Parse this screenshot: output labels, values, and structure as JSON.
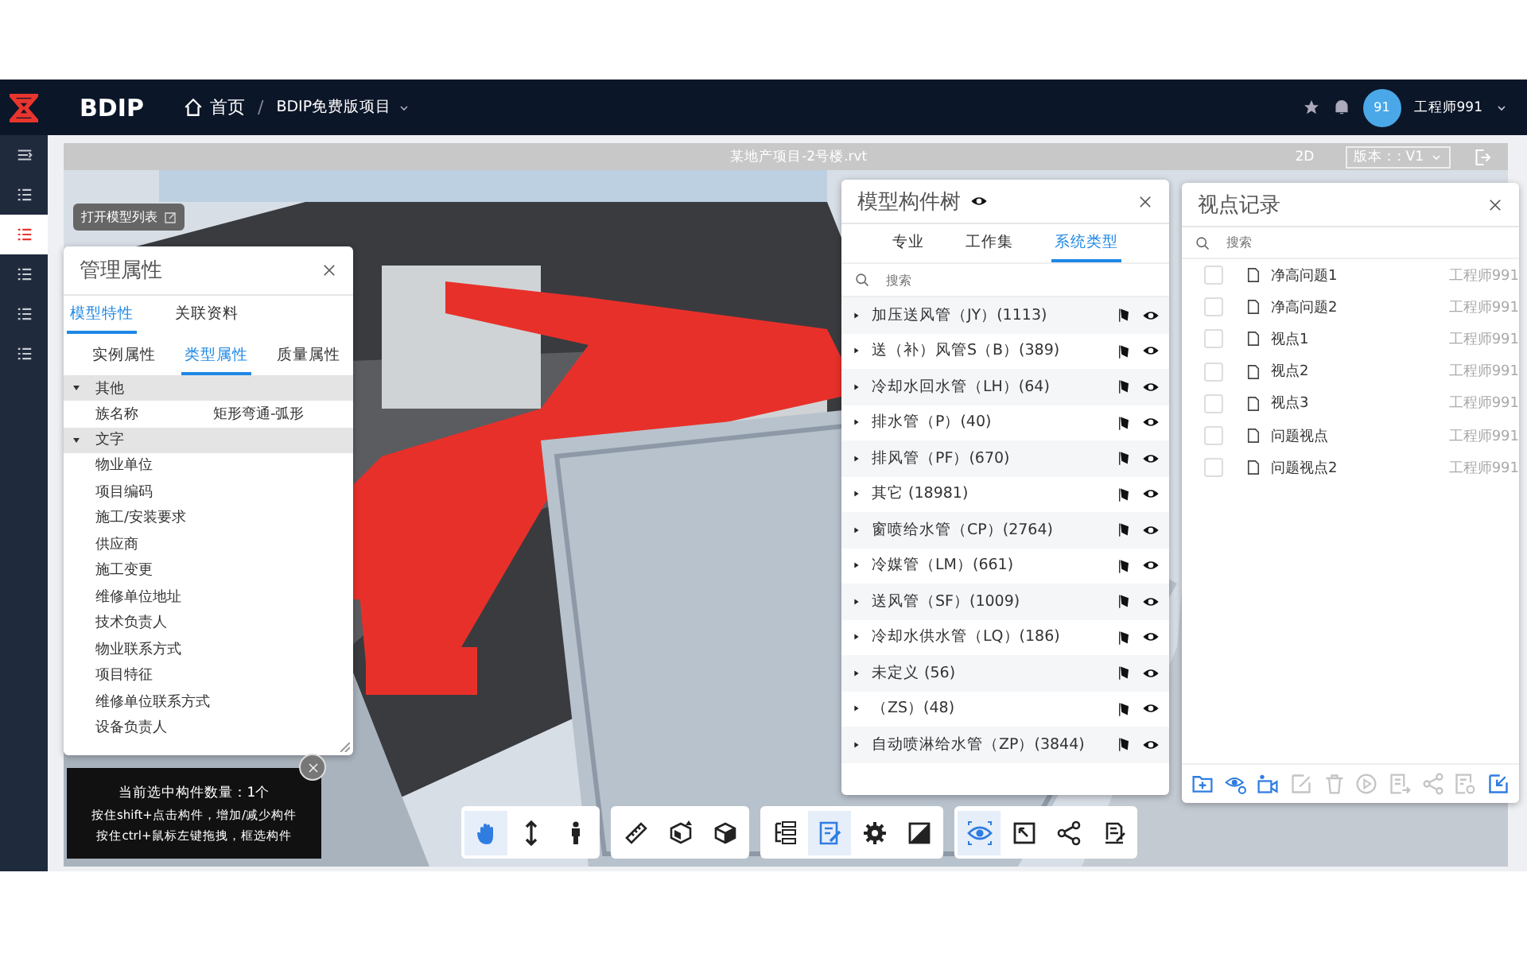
{
  "topbar": {
    "brand": "BDIP",
    "separator": "/",
    "breadcrumb": [
      {
        "label": "首页",
        "kind": "home"
      },
      {
        "label": "BDIP免费版项目",
        "kind": "dropdown"
      }
    ],
    "user": {
      "avatar": "91",
      "name": "工程师991"
    }
  },
  "sidebar": {
    "items": [
      {
        "kind": "collapse",
        "selected": false
      },
      {
        "kind": "list",
        "selected": false
      },
      {
        "kind": "list",
        "selected": true
      },
      {
        "kind": "list",
        "selected": false
      },
      {
        "kind": "list",
        "selected": false
      },
      {
        "kind": "list",
        "selected": false
      }
    ]
  },
  "viewer": {
    "file_title": "某地产项目-2号楼.rvt",
    "mode": "2D",
    "version": "版本：: V1",
    "open_model_list": "打开模型列表"
  },
  "properties_panel": {
    "title": "管理属性",
    "tabs": [
      {
        "label": "模型特性",
        "selected": true
      },
      {
        "label": "关联资料",
        "selected": false
      }
    ],
    "subtabs": [
      {
        "label": "实例属性",
        "selected": false
      },
      {
        "label": "类型属性",
        "selected": true
      },
      {
        "label": "质量属性",
        "selected": false
      }
    ],
    "groups": [
      {
        "name": "其他",
        "expanded": true,
        "rows": [
          {
            "label": "族名称",
            "value": "矩形弯通-弧形"
          }
        ]
      },
      {
        "name": "文字",
        "expanded": true,
        "rows": [
          {
            "label": "物业单位"
          },
          {
            "label": "项目编码"
          },
          {
            "label": "施工/安装要求"
          },
          {
            "label": "供应商"
          },
          {
            "label": "施工变更"
          },
          {
            "label": "维修单位地址"
          },
          {
            "label": "技术负责人"
          },
          {
            "label": "物业联系方式"
          },
          {
            "label": "项目特征"
          },
          {
            "label": "维修单位联系方式"
          },
          {
            "label": "设备负责人"
          }
        ]
      }
    ]
  },
  "tree_panel": {
    "title": "模型构件树",
    "tabs": [
      {
        "label": "专业",
        "selected": false
      },
      {
        "label": "工作集",
        "selected": false
      },
      {
        "label": "系统类型",
        "selected": true
      }
    ],
    "search": {
      "placeholder": "搜索"
    },
    "items": [
      {
        "label": "加压送风管（JY）(1113)"
      },
      {
        "label": "送（补）风管S（B）(389)"
      },
      {
        "label": "冷却水回水管（LH）(64)"
      },
      {
        "label": "排水管（P）(40)"
      },
      {
        "label": "排风管（PF）(670)"
      },
      {
        "label": "其它 (18981)"
      },
      {
        "label": "窗喷给水管（CP）(2764)"
      },
      {
        "label": "冷媒管（LM）(661)"
      },
      {
        "label": "送风管（SF）(1009)"
      },
      {
        "label": "冷却水供水管（LQ）(186)"
      },
      {
        "label": "未定义 (56)"
      },
      {
        "label": "（ZS）(48)"
      },
      {
        "label": "自动喷淋给水管（ZP）(3844)"
      }
    ]
  },
  "viewpoints_panel": {
    "title": "视点记录",
    "search": {
      "placeholder": "搜索"
    },
    "items": [
      {
        "name": "净高问题1",
        "author": "工程师991",
        "checked": false
      },
      {
        "name": "净高问题2",
        "author": "工程师991",
        "checked": false
      },
      {
        "name": "视点1",
        "author": "工程师991",
        "checked": false
      },
      {
        "name": "视点2",
        "author": "工程师991",
        "checked": false
      },
      {
        "name": "视点3",
        "author": "工程师991",
        "checked": false
      },
      {
        "name": "问题视点",
        "author": "工程师991",
        "checked": false
      },
      {
        "name": "问题视点2",
        "author": "工程师991",
        "checked": false
      }
    ],
    "actions": [
      {
        "kind": "add-folder",
        "disabled": false
      },
      {
        "kind": "eye-gear",
        "disabled": false
      },
      {
        "kind": "video",
        "disabled": false
      },
      {
        "kind": "edit",
        "disabled": true
      },
      {
        "kind": "trash",
        "disabled": true
      },
      {
        "kind": "play",
        "disabled": true
      },
      {
        "kind": "export",
        "disabled": true
      },
      {
        "kind": "share",
        "disabled": true
      },
      {
        "kind": "doc-gear",
        "disabled": true
      },
      {
        "kind": "import",
        "disabled": false
      }
    ]
  },
  "selection_tip": {
    "lines": [
      "当前选中构件数量：1个",
      "按住shift+点击构件，增加/减少构件",
      "按住ctrl+鼠标左键拖拽，框选构件"
    ]
  },
  "toolbar": {
    "groups": [
      [
        {
          "kind": "hand",
          "selected": true
        },
        {
          "kind": "updown",
          "selected": false
        },
        {
          "kind": "person",
          "selected": false
        }
      ],
      [
        {
          "kind": "ruler",
          "selected": false
        },
        {
          "kind": "section-box",
          "selected": false
        },
        {
          "kind": "cube",
          "selected": false
        }
      ],
      [
        {
          "kind": "tree",
          "selected": false
        },
        {
          "kind": "doc-edit",
          "selected": true
        },
        {
          "kind": "gear",
          "selected": false
        },
        {
          "kind": "contrast",
          "selected": false
        }
      ],
      [
        {
          "kind": "eye-view",
          "selected": true
        },
        {
          "kind": "frame",
          "selected": false
        },
        {
          "kind": "share",
          "selected": false
        },
        {
          "kind": "notes",
          "selected": false
        }
      ]
    ]
  }
}
